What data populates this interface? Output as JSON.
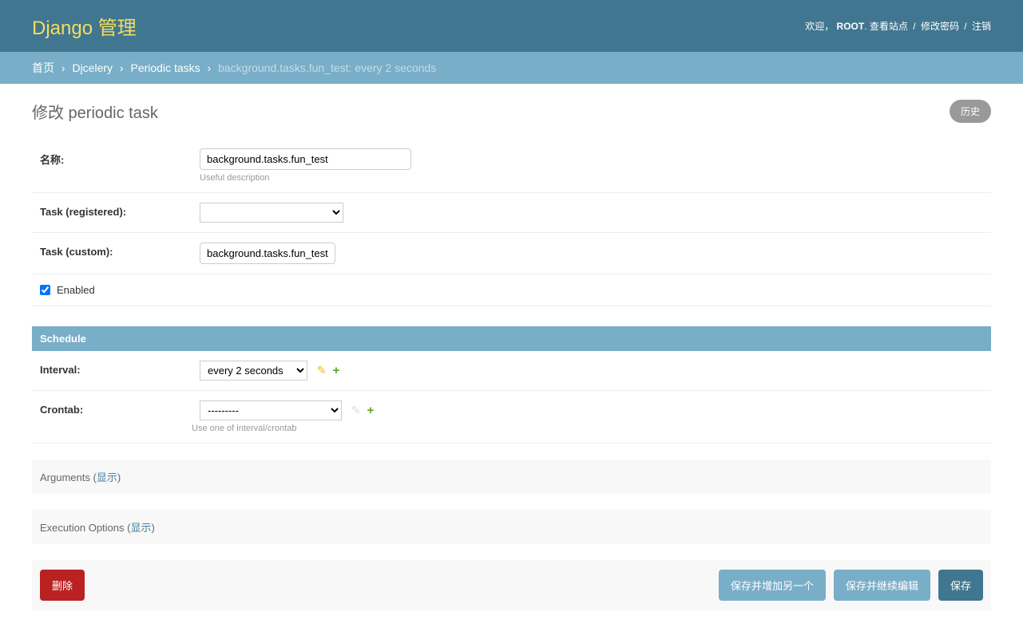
{
  "header": {
    "branding": "Django 管理",
    "welcome": "欢迎，",
    "username": "ROOT",
    "view_site": "查看站点",
    "change_password": "修改密码",
    "logout": "注销"
  },
  "breadcrumbs": {
    "home": "首页",
    "app": "Djcelery",
    "model": "Periodic tasks",
    "current": "background.tasks.fun_test: every 2 seconds"
  },
  "page": {
    "title": "修改 periodic task",
    "history_btn": "历史"
  },
  "form": {
    "name": {
      "label": "名称:",
      "value": "background.tasks.fun_test",
      "help": "Useful description"
    },
    "task_registered": {
      "label": "Task (registered):",
      "value": ""
    },
    "task_custom": {
      "label": "Task (custom):",
      "value": "background.tasks.fun_test"
    },
    "enabled": {
      "label": "Enabled",
      "checked": true
    }
  },
  "schedule": {
    "header": "Schedule",
    "interval": {
      "label": "Interval:",
      "value": "every 2 seconds"
    },
    "crontab": {
      "label": "Crontab:",
      "value": "---------",
      "help": "Use one of interval/crontab"
    }
  },
  "collapsed": {
    "arguments": {
      "prefix": "Arguments (",
      "link": "显示",
      "suffix": ")"
    },
    "execution": {
      "prefix": "Execution Options (",
      "link": "显示",
      "suffix": ")"
    }
  },
  "actions": {
    "delete": "删除",
    "save_add_another": "保存并增加另一个",
    "save_continue": "保存并继续编辑",
    "save": "保存"
  }
}
